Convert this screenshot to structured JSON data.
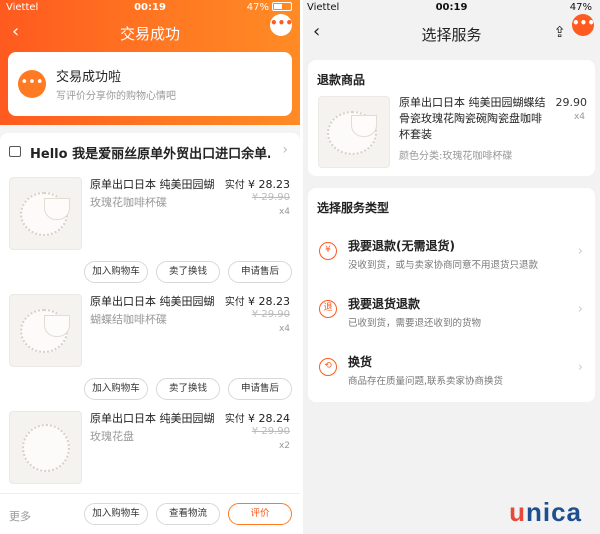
{
  "left": {
    "status": {
      "carrier": "Viettel",
      "time": "00:19",
      "battery": "47%"
    },
    "nav": {
      "title": "交易成功",
      "back": "‹",
      "more": "•••"
    },
    "success": {
      "title": "交易成功啦",
      "subtitle": "写评价分享你的购物心情吧"
    },
    "shop": {
      "name": "Hello 我是爱丽丝原单外贸出口进口余单…",
      "chevron": "›"
    },
    "items": [
      {
        "name": "原单出口日本 纯美田园蝴",
        "sku": "玫瑰花咖啡杯碟",
        "paid_label": "实付",
        "paid": "¥ 28.23",
        "orig": "¥ 29.90",
        "qty": "x4",
        "buttons": [
          "加入购物车",
          "卖了换钱",
          "申请售后"
        ]
      },
      {
        "name": "原单出口日本 纯美田园蝴",
        "sku": "蝴蝶结咖啡杯碟",
        "paid_label": "实付",
        "paid": "¥ 28.23",
        "orig": "¥ 29.90",
        "qty": "x4",
        "buttons": [
          "加入购物车",
          "卖了换钱",
          "申请售后"
        ]
      },
      {
        "name": "原单出口日本 纯美田园蝴",
        "sku": "玫瑰花盘",
        "paid_label": "实付",
        "paid": "¥ 28.24",
        "orig": "¥ 29.90",
        "qty": "x2",
        "buttons": [
          "加入购物车",
          "卖了换钱",
          "申请售后"
        ]
      }
    ],
    "bottom": {
      "more": "更多",
      "add_cart": "加入购物车",
      "logistics": "查看物流",
      "review": "评价"
    }
  },
  "right": {
    "status": {
      "carrier": "Viettel",
      "time": "00:19",
      "battery": "47%"
    },
    "nav": {
      "title": "选择服务",
      "back": "‹",
      "share": "⇪",
      "more": "•••"
    },
    "refund_goods": {
      "heading": "退款商品",
      "name": "原单出口日本 纯美田园蝴蝶结骨瓷玫瑰花陶瓷碗陶瓷盘咖啡杯套装",
      "variant": "颜色分类:玫瑰花咖啡杯碟",
      "price": "29.90",
      "qty": "x4"
    },
    "service": {
      "heading": "选择服务类型",
      "options": [
        {
          "icon": "¥",
          "title": "我要退款(无需退货)",
          "desc": "没收到货，或与卖家协商同意不用退货只退款"
        },
        {
          "icon": "退",
          "title": "我要退货退款",
          "desc": "已收到货，需要退还收到的货物"
        },
        {
          "icon": "⟲",
          "title": "换货",
          "desc": "商品存在质量问题,联系卖家协商换货"
        }
      ]
    }
  },
  "logo": {
    "u": "u",
    "rest": "nica"
  },
  "colors": {
    "accent": "#ff5a1f",
    "logo_red": "#e84a3a",
    "logo_blue": "#1d4f8f"
  }
}
